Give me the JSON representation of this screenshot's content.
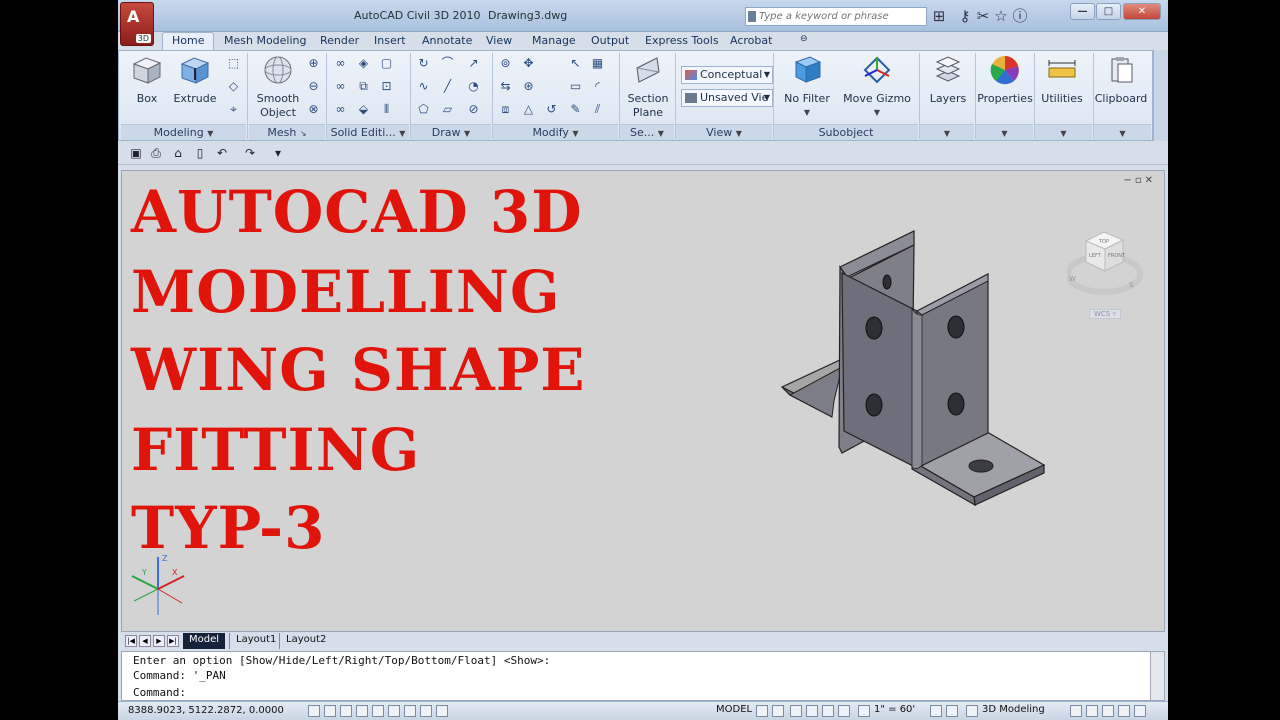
{
  "window": {
    "title": "AutoCAD Civil 3D 2010",
    "document": "Drawing3.dwg",
    "app_button_badge": "3D",
    "search_placeholder": "Type a keyword or phrase",
    "controls": [
      "minimize",
      "maximize",
      "close"
    ]
  },
  "ribbon_tabs": [
    "Home",
    "Mesh Modeling",
    "Render",
    "Insert",
    "Annotate",
    "View",
    "Manage",
    "Output",
    "Express Tools",
    "Acrobat"
  ],
  "active_tab": "Home",
  "ribbon": {
    "box_label": "Box",
    "extrude_label": "Extrude",
    "smooth_object_label_1": "Smooth",
    "smooth_object_label_2": "Object",
    "section_plane_label_1": "Section",
    "section_plane_label_2": "Plane",
    "visual_style": "Conceptual",
    "named_view": "Unsaved Vie",
    "no_filter_label": "No Filter",
    "move_gizmo_label": "Move Gizmo",
    "layers_label": "Layers",
    "properties_label": "Properties",
    "utilities_label": "Utilities",
    "clipboard_label": "Clipboard",
    "panels": {
      "modeling": "Modeling",
      "mesh": "Mesh",
      "solid_editing": "Solid Editi...",
      "draw": "Draw",
      "modify": "Modify",
      "section": "Se...",
      "view": "View",
      "subobject": "Subobject"
    }
  },
  "overlay_title": {
    "line1": "AUTOCAD 3D",
    "line2": "MODELLING",
    "line3": "WING SHAPE",
    "line4": "FITTING",
    "line5": "TYP-3"
  },
  "viewcube": {
    "top": "TOP",
    "left": "LEFT",
    "front": "FRONT",
    "compass_w": "W",
    "compass_s": "S",
    "wcs": "WCS"
  },
  "ucs": {
    "z": "Z",
    "y": "Y",
    "x": "X"
  },
  "layout_tabs": [
    "Model",
    "Layout1",
    "Layout2"
  ],
  "command_line": {
    "history1": "Enter an option [Show/Hide/Left/Right/Top/Bottom/Float] <Show>:",
    "history2": "Command: '_PAN",
    "prompt": "Command:"
  },
  "status_bar": {
    "coordinates": "8388.9023, 5122.2872, 0.0000",
    "model": "MODEL",
    "annotation_scale": "1\" = 60'",
    "workspace": "3D Modeling"
  },
  "colors": {
    "title_red": "#e0140a",
    "viewport_bg": "#d3d3d3",
    "ribbon_bg": "#dbe5f1"
  }
}
